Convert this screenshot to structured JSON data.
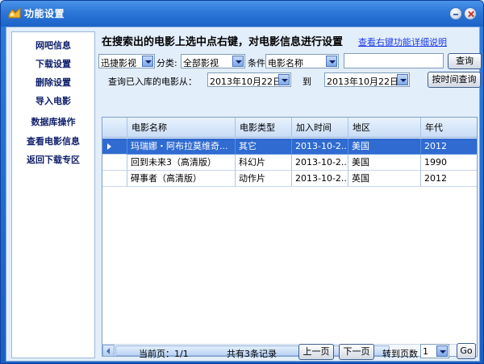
{
  "window": {
    "title": "功能设置"
  },
  "sidebar": {
    "items": [
      {
        "label": "网吧信息"
      },
      {
        "label": "下载设置"
      },
      {
        "label": "删除设置"
      },
      {
        "label": "导入电影"
      },
      {
        "label": "数据库操作"
      },
      {
        "label": "查看电影信息"
      },
      {
        "label": "返回下载专区"
      }
    ]
  },
  "main": {
    "heading": "在搜索出的电影上选中点右键，对电影信息进行设置",
    "help_link": "查看右键功能详细说明"
  },
  "search": {
    "source": "迅捷影视",
    "category_label": "分类:",
    "category": "全部影视",
    "condition_label": "条件",
    "condition": "电影名称",
    "query": "",
    "query_button": "查询"
  },
  "date_filter": {
    "label": "查询已入库的电影从：",
    "from": "2013年10月22日",
    "to_label": "到",
    "to": "2013年10月22日",
    "button": "按时间查询"
  },
  "table": {
    "columns": [
      "电影名称",
      "电影类型",
      "加入时间",
      "地区",
      "年代"
    ],
    "rows": [
      [
        "玛瑞娜・阿布拉莫维奇...",
        "其它",
        "2013-10-2...",
        "美国",
        "2012"
      ],
      [
        "回到未来3（高清版）",
        "科幻片",
        "2013-10-2...",
        "美国",
        "1990"
      ],
      [
        "碍事者（高清版）",
        "动作片",
        "2013-10-2...",
        "英国",
        "2012"
      ]
    ],
    "selected_row": 0
  },
  "pager": {
    "current_page": "当前页：1/1",
    "total": "共有3条记录",
    "prev": "上一页",
    "next": "下一页",
    "goto_label": "转到页数",
    "page_value": "1",
    "go": "Go"
  },
  "colors": {
    "title_bar": "#2c76d8",
    "selection": "#2f6bd0",
    "sidebar_text": "#10206c",
    "link": "#1c3be8"
  }
}
